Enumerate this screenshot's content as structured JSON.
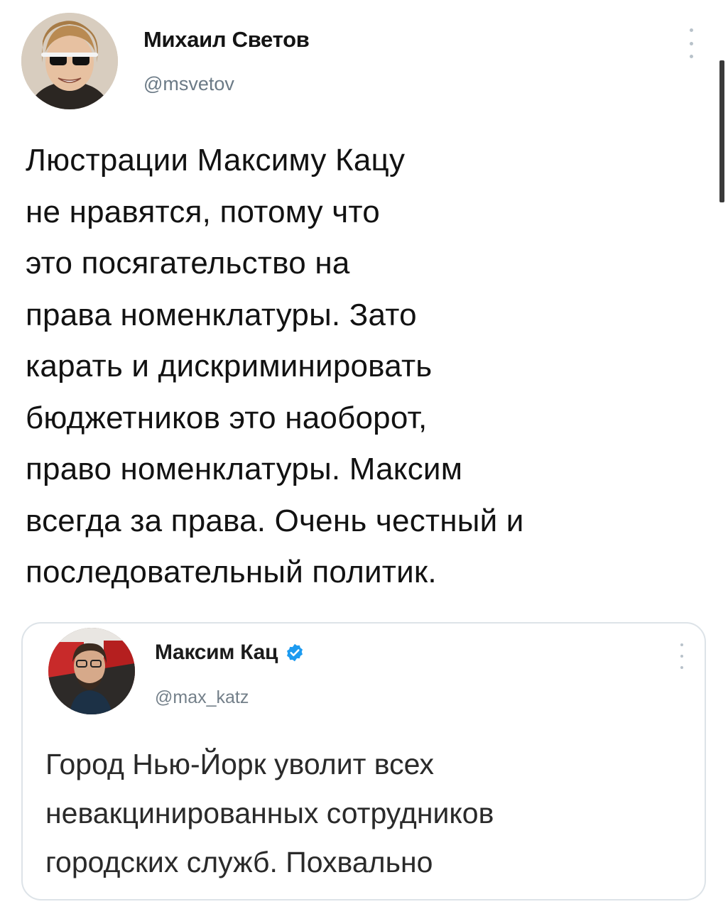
{
  "tweet": {
    "author_name": "Михаил Светов",
    "author_handle": "@msvetov",
    "text": "Люстрации Максиму Кацу\nне нравятся, потому что\nэто посягательство на\nправа номенклатуры. Зато\nкарать и дискриминировать\nбюджетников это наоборот,\nправо номенклатуры. Максим\nвсегда за права. Очень честный и\nпоследовательный политик."
  },
  "quoted_tweet": {
    "author_name": "Максим Кац",
    "author_handle": "@max_katz",
    "verified": true,
    "text": "Город Нью-Йорк уволит всех\nневакцинированных сотрудников\nгородских служб. Похвально"
  },
  "colors": {
    "verified_blue": "#1d9bf0",
    "handle_gray": "#6b7a86",
    "border": "#dde3e8"
  },
  "icons": {
    "more": "more-vertical-icon",
    "verified": "verified-badge-icon"
  }
}
